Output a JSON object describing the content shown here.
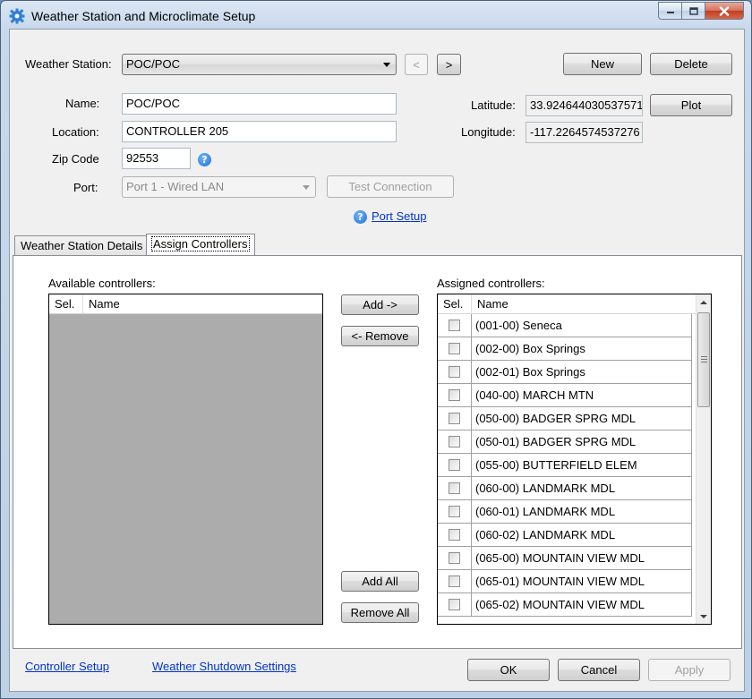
{
  "window": {
    "title": "Weather Station and Microclimate Setup",
    "accent": "#1d6fd0"
  },
  "station": {
    "label": "Weather Station:",
    "selected": "POC/POC",
    "prev_label": "<",
    "next_label": ">",
    "new_label": "New",
    "delete_label": "Delete"
  },
  "fields": {
    "name_label": "Name:",
    "name_value": "POC/POC",
    "location_label": "Location:",
    "location_value": "CONTROLLER 205",
    "zip_label": "Zip Code",
    "zip_value": "92553",
    "help_glyph": "?",
    "port_label": "Port:",
    "port_value": "Port 1 - Wired LAN",
    "test_connection_label": "Test Connection",
    "latitude_label": "Latitude:",
    "latitude_value": "33.924644030537571",
    "longitude_label": "Longitude:",
    "longitude_value": "-117.2264574537276",
    "plot_label": "Plot",
    "port_setup_label": "Port Setup"
  },
  "tabs": [
    {
      "label": "Weather Station Details",
      "active": false
    },
    {
      "label": "Assign Controllers",
      "active": true
    }
  ],
  "available": {
    "label": "Available controllers:",
    "columns": [
      "Sel.",
      "Name"
    ],
    "rows": []
  },
  "buttons": {
    "add": "Add ->",
    "remove": "<- Remove",
    "add_all": "Add All",
    "remove_all": "Remove All"
  },
  "assigned": {
    "label": "Assigned controllers:",
    "columns": [
      "Sel.",
      "Name"
    ],
    "rows": [
      "(001-00) Seneca",
      "(002-00) Box Springs",
      "(002-01) Box Springs",
      "(040-00) MARCH MTN",
      "(050-00) BADGER SPRG MDL",
      "(050-01) BADGER SPRG MDL",
      "(055-00) BUTTERFIELD ELEM",
      "(060-00) LANDMARK MDL",
      "(060-01) LANDMARK MDL",
      "(060-02) LANDMARK MDL",
      "(065-00) MOUNTAIN VIEW MDL",
      "(065-01) MOUNTAIN VIEW MDL",
      "(065-02) MOUNTAIN VIEW MDL"
    ]
  },
  "footer": {
    "controller_setup": "Controller Setup",
    "weather_shutdown": "Weather Shutdown Settings",
    "ok": "OK",
    "cancel": "Cancel",
    "apply": "Apply"
  },
  "icons": {
    "app": "gear-icon",
    "minimize": "minimize-icon",
    "maximize": "maximize-icon",
    "close": "close-icon",
    "help": "help-icon",
    "checkbox": "checkbox-icon"
  }
}
